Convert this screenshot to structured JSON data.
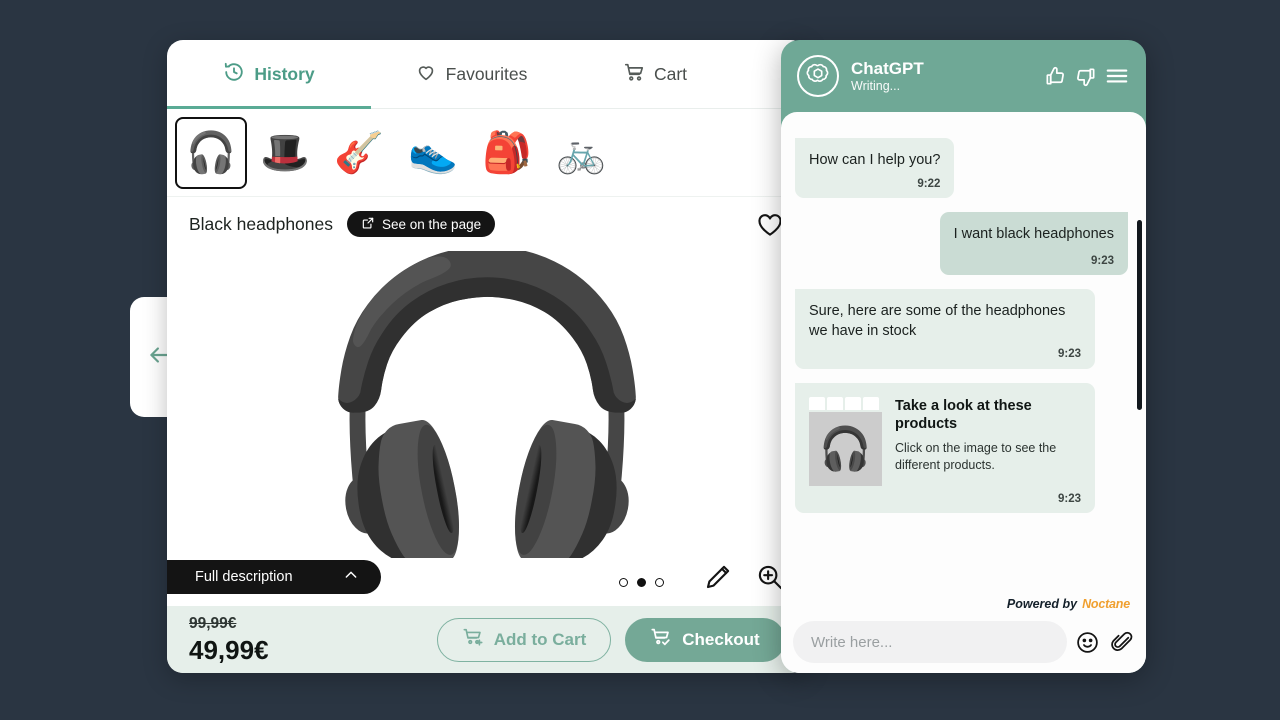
{
  "theme": {
    "background": "#2a3542",
    "accent_green": "#6fa896",
    "accent_green_dark": "#4c9c87",
    "bubble_bot": "#e6efea",
    "bubble_user": "#cadcd4",
    "footer_bar": "#e6efea",
    "black_pill": "#141414",
    "brand_orange": "#f0a030"
  },
  "drawer": {
    "back_icon": "arrow-left-icon"
  },
  "product": {
    "tabs": [
      {
        "label": "History",
        "icon": "history-clock-icon",
        "active": true
      },
      {
        "label": "Favourites",
        "icon": "heart-icon",
        "active": false
      },
      {
        "label": "Cart",
        "icon": "cart-icon",
        "active": false
      }
    ],
    "thumbnails": [
      {
        "name": "headphones",
        "glyph": "🎧",
        "selected": true
      },
      {
        "name": "hat",
        "glyph": "🎩",
        "selected": false
      },
      {
        "name": "guitar",
        "glyph": "🎸",
        "selected": false
      },
      {
        "name": "sneakers",
        "glyph": "👟",
        "selected": false
      },
      {
        "name": "backpack",
        "glyph": "🎒",
        "selected": false
      },
      {
        "name": "bicycle",
        "glyph": "🚲",
        "selected": false
      }
    ],
    "title": "Black headphones",
    "see_on_page_label": "See on the page",
    "favourite_icon": "heart-outline-icon",
    "hero_glyph": "🎧",
    "full_description_label": "Full description",
    "carousel": {
      "count": 3,
      "active_index": 1
    },
    "tools": [
      {
        "name": "edit-pencil-icon"
      },
      {
        "name": "zoom-in-icon"
      }
    ],
    "old_price": "99,99€",
    "new_price": "49,99€",
    "add_to_cart_label": "Add to Cart",
    "checkout_label": "Checkout"
  },
  "chat": {
    "name": "ChatGPT",
    "status": "Writing...",
    "logo_icon": "openai-logo-icon",
    "header_icons": [
      {
        "name": "thumbs-up-icon"
      },
      {
        "name": "thumbs-down-icon"
      },
      {
        "name": "hamburger-menu-icon"
      }
    ],
    "messages": [
      {
        "from": "bot",
        "text": "How can I help you?",
        "time": "9:22"
      },
      {
        "from": "user",
        "text": "I want black headphones",
        "time": "9:23"
      },
      {
        "from": "bot",
        "text": "Sure, here are some of the headphones we have in stock",
        "time": "9:23"
      }
    ],
    "card": {
      "title": "Take a look at these products",
      "subtitle": "Click on the image to see the different products.",
      "time": "9:23",
      "thumb_glyph": "🎧"
    },
    "powered_by_prefix": "Powered by",
    "powered_by_brand": "Noctane",
    "composer": {
      "placeholder": "Write here...",
      "value": "",
      "emoji_icon": "smiley-icon",
      "attach_icon": "paperclip-icon"
    }
  }
}
